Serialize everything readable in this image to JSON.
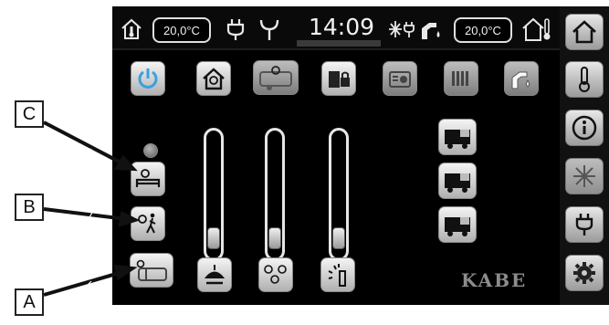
{
  "topbar": {
    "indoor_temp": "20,0°C",
    "time": "14:09",
    "outdoor_temp": "20,0°C"
  },
  "brand": "KABE",
  "callouts": {
    "a": "A",
    "b": "B",
    "c": "C"
  },
  "function_row": [
    "power-icon",
    "house-light-icon",
    "caravan-light-icon",
    "lock-icon",
    "radio-icon",
    "radiator-icon",
    "water-tap-icon"
  ],
  "left_buttons": [
    "bed-light-icon",
    "person-light-icon",
    "awning-light-icon"
  ],
  "sliders": [
    {
      "name": "ceiling-lamp",
      "level": 0.08
    },
    {
      "name": "spot-lights",
      "level": 0.08
    },
    {
      "name": "wall-light",
      "level": 0.08
    }
  ],
  "sidebar": [
    "home-icon",
    "thermometer-icon",
    "info-icon",
    "snowflake-icon",
    "power-plug-icon",
    "settings-icon"
  ]
}
